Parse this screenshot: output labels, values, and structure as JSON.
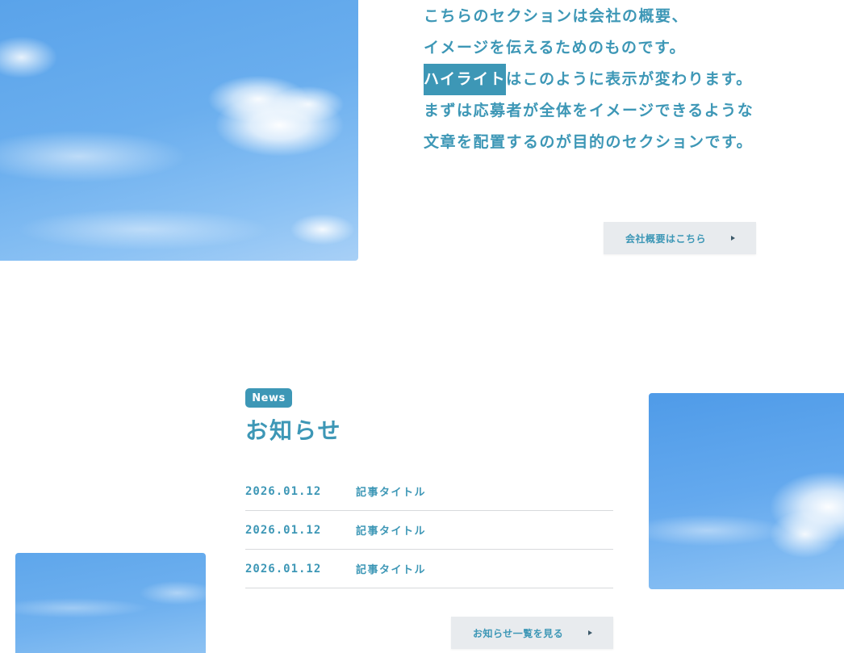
{
  "about": {
    "lines": [
      "こちらのセクションは会社の概要、",
      "イメージを伝えるためのものです。",
      "はこのように表示が変わります。",
      "まずは応募者が全体をイメージできるような",
      "文章を配置するのが目的のセクションです。"
    ],
    "highlight_word": "ハイライト",
    "button_label": "会社概要はこちら"
  },
  "news": {
    "badge": "News",
    "title": "お知らせ",
    "items": [
      {
        "date": "2026.01.12",
        "title": "記事タイトル"
      },
      {
        "date": "2026.01.12",
        "title": "記事タイトル"
      },
      {
        "date": "2026.01.12",
        "title": "記事タイトル"
      }
    ],
    "button_label": "お知らせ一覧を見る"
  },
  "icons": {
    "button_arrow": "triangle-right-icon"
  },
  "colors": {
    "accent": "#3d97b6",
    "button_bg": "#e8ebee",
    "divider": "#d8dadc",
    "background": "#ffffff"
  }
}
